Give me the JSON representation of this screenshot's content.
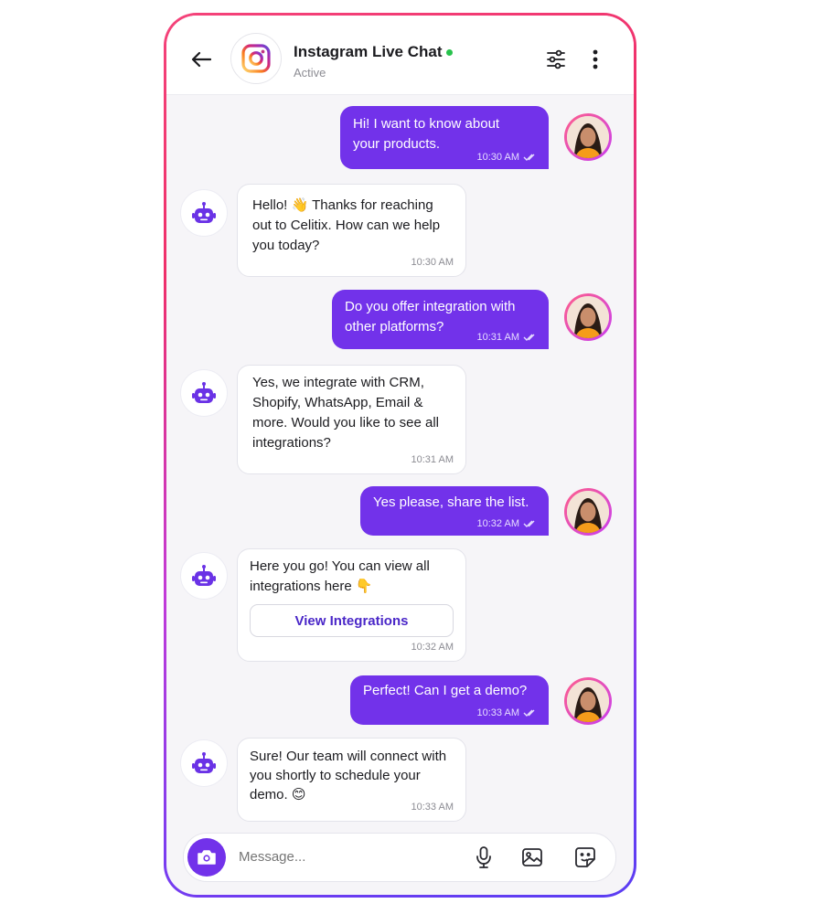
{
  "header": {
    "title": "Instagram Live Chat",
    "status": "Active"
  },
  "colors": {
    "accent": "#7232ea",
    "online": "#27c24c"
  },
  "messages": [
    {
      "from": "user",
      "text": "Hi! I want to know about your products.",
      "time": "10:30 AM"
    },
    {
      "from": "bot",
      "text": "Hello! 👋 Thanks for reaching out to Celitix. How can we help you today?",
      "time": "10:30 AM"
    },
    {
      "from": "user",
      "text": "Do you offer integration with other platforms?",
      "time": "10:31 AM"
    },
    {
      "from": "bot",
      "text": "Yes, we integrate with CRM, Shopify, WhatsApp, Email & more. Would you like to see all integrations?",
      "time": "10:31 AM"
    },
    {
      "from": "user",
      "text": "Yes please, share the list.",
      "time": "10:32 AM"
    },
    {
      "from": "bot",
      "text": "Here you go! You can view all integrations here 👇",
      "button": "View Integrations",
      "time": "10:32 AM"
    },
    {
      "from": "user",
      "text": "Perfect! Can I get a demo?",
      "time": "10:33 AM"
    },
    {
      "from": "bot",
      "text": "Sure! Our team will connect with you shortly to schedule your demo. 😊",
      "time": "10:33 AM"
    }
  ],
  "composer": {
    "placeholder": "Message..."
  },
  "icons": [
    "back-arrow-icon",
    "instagram-logo-icon",
    "filter-sliders-icon",
    "more-vertical-icon",
    "robot-icon",
    "camera-icon",
    "microphone-icon",
    "image-icon",
    "sticker-icon",
    "double-check-icon"
  ]
}
